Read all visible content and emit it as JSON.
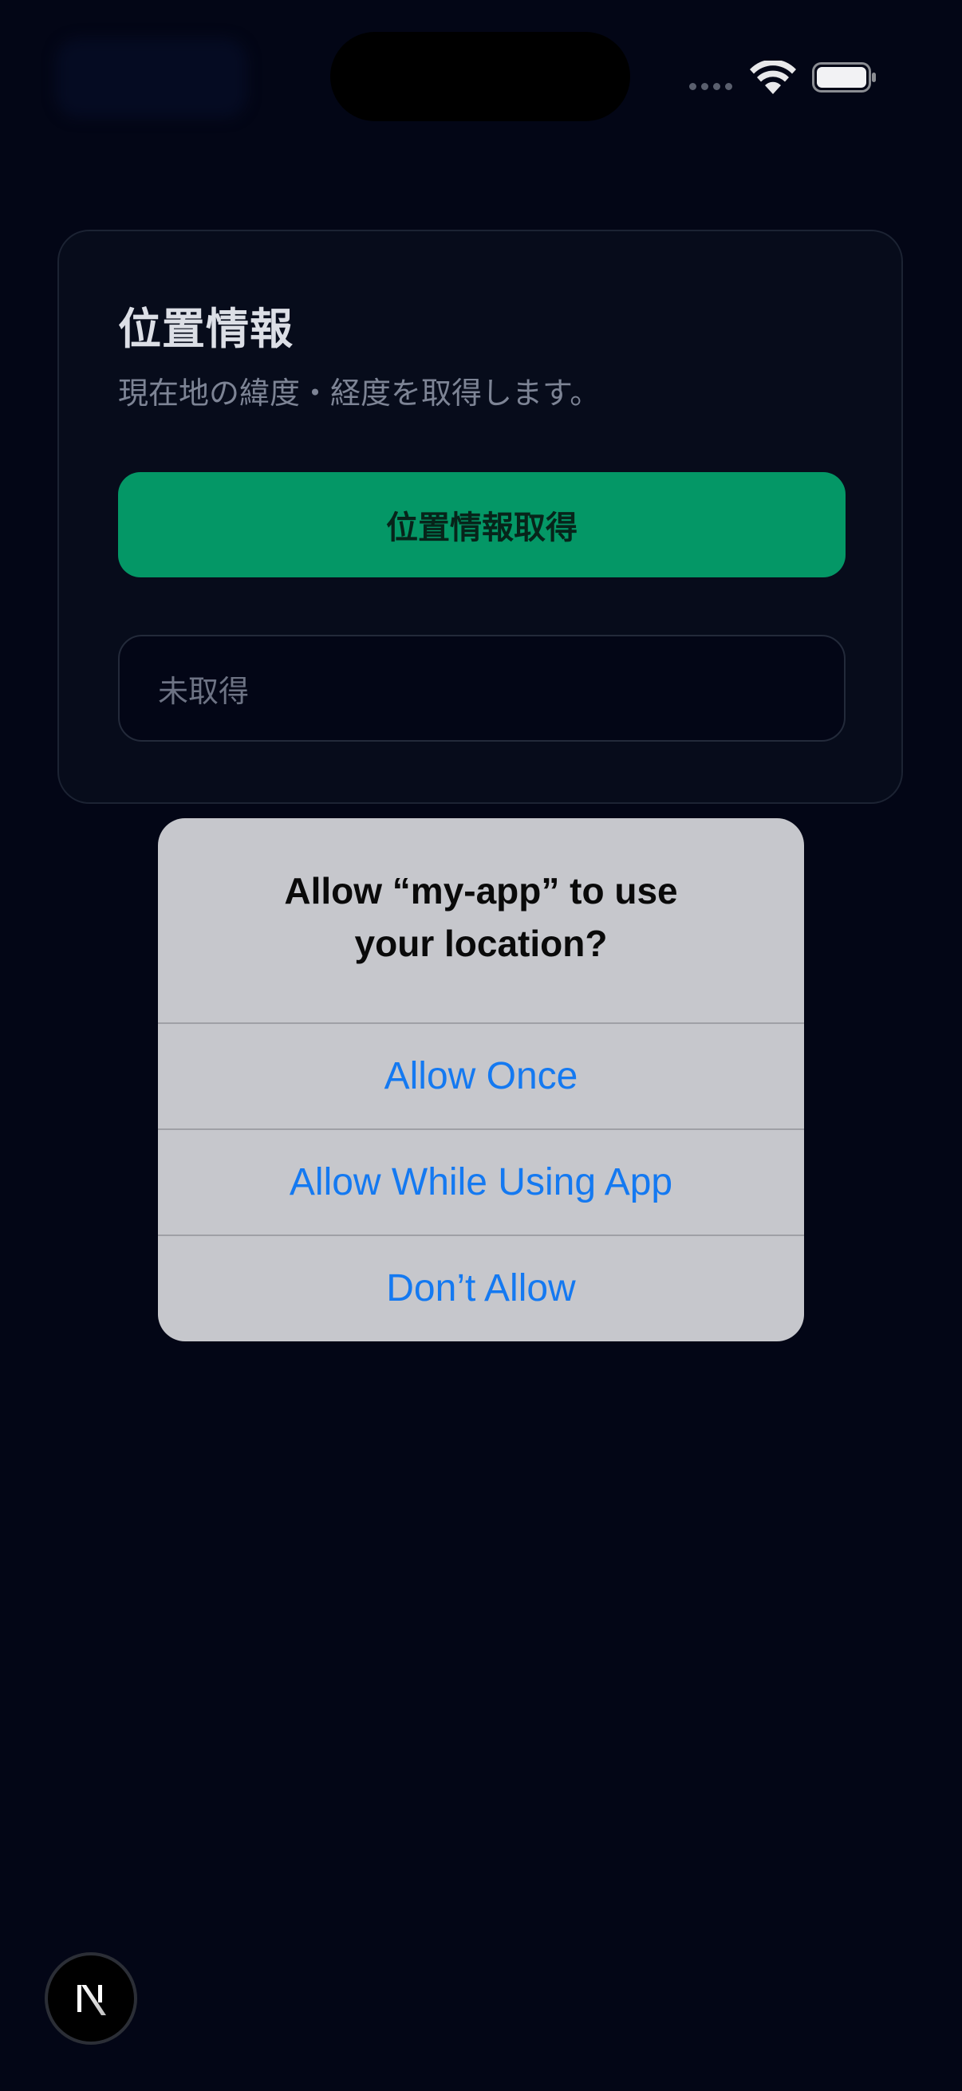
{
  "status_bar": {
    "wifi_icon": "wifi-icon",
    "battery_icon": "battery-icon"
  },
  "card": {
    "title": "位置情報",
    "subtitle": "現在地の緯度・経度を取得します。",
    "button_label": "位置情報取得",
    "result_text": "未取得"
  },
  "alert": {
    "title_line1": "Allow “my-app” to use",
    "title_line2": "your location?",
    "actions": [
      {
        "label": "Allow Once"
      },
      {
        "label": "Allow While Using App"
      },
      {
        "label": "Don’t Allow"
      }
    ]
  },
  "dev_indicator": {
    "icon": "nextjs-logo-icon"
  },
  "colors": {
    "background": "#030616",
    "button_green": "#049766",
    "alert_background": "#c6c7cc",
    "alert_action_blue": "#1479f1"
  }
}
